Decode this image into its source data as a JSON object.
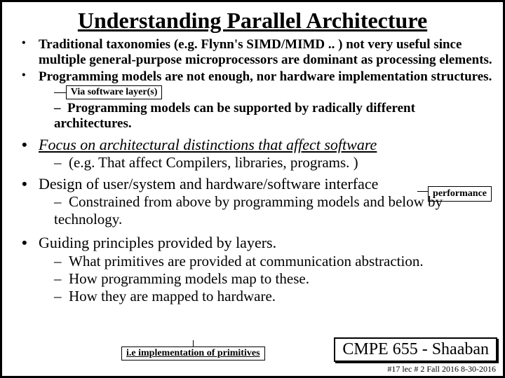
{
  "title": "Understanding Parallel Architecture",
  "b1": "Traditional taxonomies (e.g. Flynn's SIMD/MIMD .. ) not very useful since multiple general-purpose microprocessors are dominant as processing elements.",
  "b2a": "Programming models are not enough, nor hardware implementation structures.",
  "b2_callout": "Via software layer(s)",
  "b2_sub": "Programming models can be supported by radically different architectures.",
  "b3": "Focus on architectural distinctions that affect software",
  "b3_callout": "performance",
  "b3_sub": "(e.g.  That affect Compilers, libraries, programs. )",
  "b4": "Design of user/system and hardware/software interface",
  "b4_sub": "Constrained from above by programming models and below by technology.",
  "b5": "Guiding principles provided by layers.",
  "b5_s1": "What primitives are provided at communication abstraction.",
  "b5_s2": "How programming models map to these.",
  "b5_s3": "How they are mapped to hardware.",
  "impl": "i.e implementation of primitives",
  "course": "CMPE 655 - Shaaban",
  "footer": "#17  lec # 2    Fall 2016   8-30-2016"
}
